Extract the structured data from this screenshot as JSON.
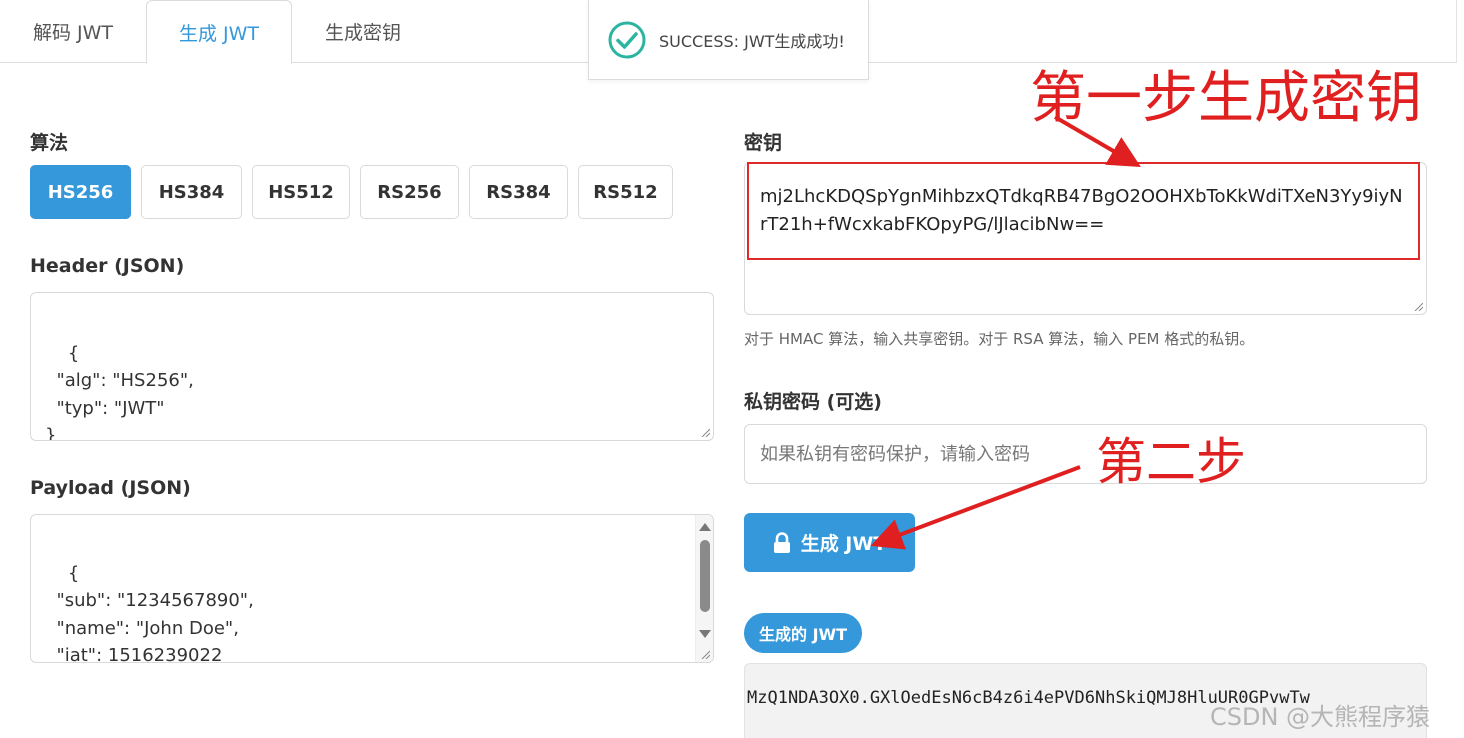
{
  "tabs": [
    {
      "label": "解码 JWT",
      "active": false
    },
    {
      "label": "生成 JWT",
      "active": true
    },
    {
      "label": "生成密钥",
      "active": false
    }
  ],
  "toast": {
    "text": "SUCCESS: JWT生成成功!"
  },
  "algorithm": {
    "label": "算法",
    "options": [
      "HS256",
      "HS384",
      "HS512",
      "RS256",
      "RS384",
      "RS512"
    ],
    "selected": "HS256"
  },
  "header_json": {
    "label": "Header (JSON)",
    "value": "{\n  \"alg\": \"HS256\",\n  \"typ\": \"JWT\"\n}"
  },
  "payload_json": {
    "label": "Payload (JSON)",
    "value": "{\n  \"sub\": \"1234567890\",\n  \"name\": \"John Doe\",\n  \"iat\": 1516239022\n}"
  },
  "secret": {
    "label": "密钥",
    "value": "mj2LhcKDQSpYgnMihbzxQTdkqRB47BgO2OOHXbToKkWdiTXeN3Yy9iyNrT21h+fWcxkabFKOpyPG/lJlacibNw==",
    "hint": "对于 HMAC 算法，输入共享密钥。对于 RSA 算法，输入 PEM 格式的私钥。"
  },
  "private_key_password": {
    "label": "私钥密码 (可选)",
    "placeholder": "如果私钥有密码保护，请输入密码"
  },
  "generate_button": {
    "label": "生成 JWT"
  },
  "result": {
    "badge": "生成的 JWT",
    "value": "MzQ1NDA3OX0.GXlOedEsN6cB4z6i4ePVD6NhSkiQMJ8HluUR0GPvwTw"
  },
  "annotations": {
    "step1": "第一步生成密钥",
    "step2": "第二步"
  },
  "watermark": "CSDN @大熊程序猿",
  "colors": {
    "primary": "#3498db",
    "annotation": "#e02020",
    "success": "#2bb5a0"
  }
}
